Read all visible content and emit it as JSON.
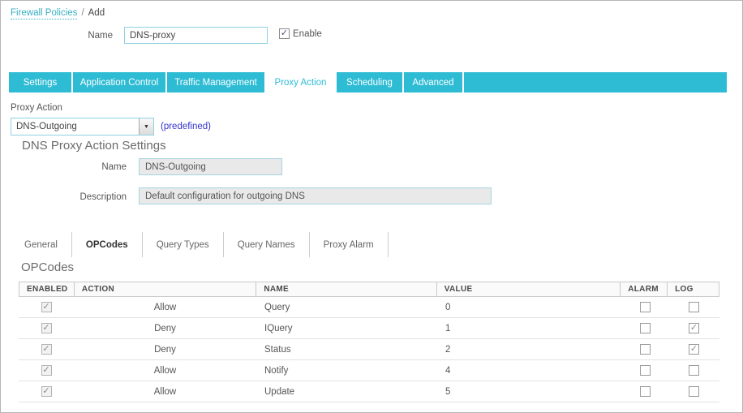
{
  "breadcrumb": {
    "link": "Firewall Policies",
    "separator": "/",
    "current": "Add"
  },
  "policy": {
    "name_label": "Name",
    "name_value": "DNS-proxy",
    "enable_label": "Enable",
    "enable_checked": true
  },
  "tabs": [
    {
      "label": "Settings",
      "active": false
    },
    {
      "label": "Application Control",
      "active": false
    },
    {
      "label": "Traffic Management",
      "active": false
    },
    {
      "label": "Proxy Action",
      "active": true
    },
    {
      "label": "Scheduling",
      "active": false
    },
    {
      "label": "Advanced",
      "active": false
    }
  ],
  "proxy_action": {
    "label": "Proxy Action",
    "selected_value": "DNS-Outgoing",
    "note": "(predefined)"
  },
  "settings_section": {
    "title": "DNS Proxy Action Settings",
    "name_label": "Name",
    "name_value": "DNS-Outgoing",
    "description_label": "Description",
    "description_value": "Default configuration for outgoing DNS"
  },
  "sub_tabs": [
    {
      "label": "General",
      "active": false
    },
    {
      "label": "OPCodes",
      "active": true
    },
    {
      "label": "Query Types",
      "active": false
    },
    {
      "label": "Query Names",
      "active": false
    },
    {
      "label": "Proxy Alarm",
      "active": false
    }
  ],
  "opcodes": {
    "title": "OPCodes",
    "columns": [
      "ENABLED",
      "ACTION",
      "NAME",
      "VALUE",
      "ALARM",
      "LOG"
    ],
    "rows": [
      {
        "enabled": true,
        "action": "Allow",
        "name": "Query",
        "value": "0",
        "alarm": false,
        "log": false
      },
      {
        "enabled": true,
        "action": "Deny",
        "name": "IQuery",
        "value": "1",
        "alarm": false,
        "log": true
      },
      {
        "enabled": true,
        "action": "Deny",
        "name": "Status",
        "value": "2",
        "alarm": false,
        "log": true
      },
      {
        "enabled": true,
        "action": "Allow",
        "name": "Notify",
        "value": "4",
        "alarm": false,
        "log": false
      },
      {
        "enabled": true,
        "action": "Allow",
        "name": "Update",
        "value": "5",
        "alarm": false,
        "log": false
      }
    ]
  },
  "icons": {
    "checkbox_check": "✓",
    "dropdown_arrow": "▼"
  },
  "colors": {
    "accent_teal": "#2ebcd4",
    "link_teal": "#38aec2",
    "predefined_blue": "#3333cc"
  }
}
